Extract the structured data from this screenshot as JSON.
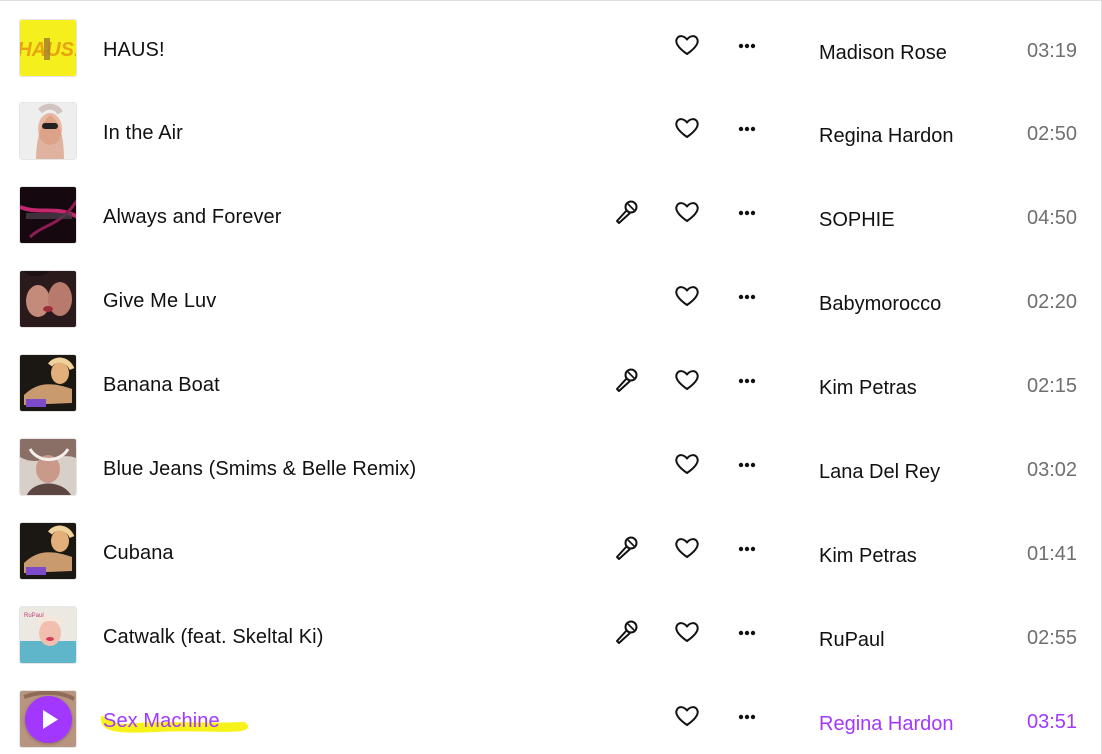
{
  "colors": {
    "accent": "#a238ff",
    "highlight": "#f7f21a",
    "duration_text": "#6f6f6f"
  },
  "icons": {
    "lyrics": "microphone-icon",
    "favorite": "heart-icon",
    "more": "more-options-icon",
    "play": "play-icon"
  },
  "tracks": [
    {
      "title": "HAUS!",
      "artist": "Madison Rose",
      "duration": "03:19",
      "has_lyrics": false,
      "current": false
    },
    {
      "title": "In the Air",
      "artist": "Regina Hardon",
      "duration": "02:50",
      "has_lyrics": false,
      "current": false
    },
    {
      "title": "Always and Forever",
      "artist": "SOPHIE",
      "duration": "04:50",
      "has_lyrics": true,
      "current": false
    },
    {
      "title": "Give Me Luv",
      "artist": "Babymorocco",
      "duration": "02:20",
      "has_lyrics": false,
      "current": false
    },
    {
      "title": "Banana Boat",
      "artist": "Kim Petras",
      "duration": "02:15",
      "has_lyrics": true,
      "current": false
    },
    {
      "title": "Blue Jeans (Smims & Belle Remix)",
      "artist": "Lana Del Rey",
      "duration": "03:02",
      "has_lyrics": false,
      "current": false
    },
    {
      "title": "Cubana",
      "artist": "Kim Petras",
      "duration": "01:41",
      "has_lyrics": true,
      "current": false
    },
    {
      "title": "Catwalk (feat. Skeltal Ki)",
      "artist": "RuPaul",
      "duration": "02:55",
      "has_lyrics": true,
      "current": false
    },
    {
      "title": "Sex Machine",
      "artist": "Regina Hardon",
      "duration": "03:51",
      "has_lyrics": false,
      "current": true
    }
  ]
}
